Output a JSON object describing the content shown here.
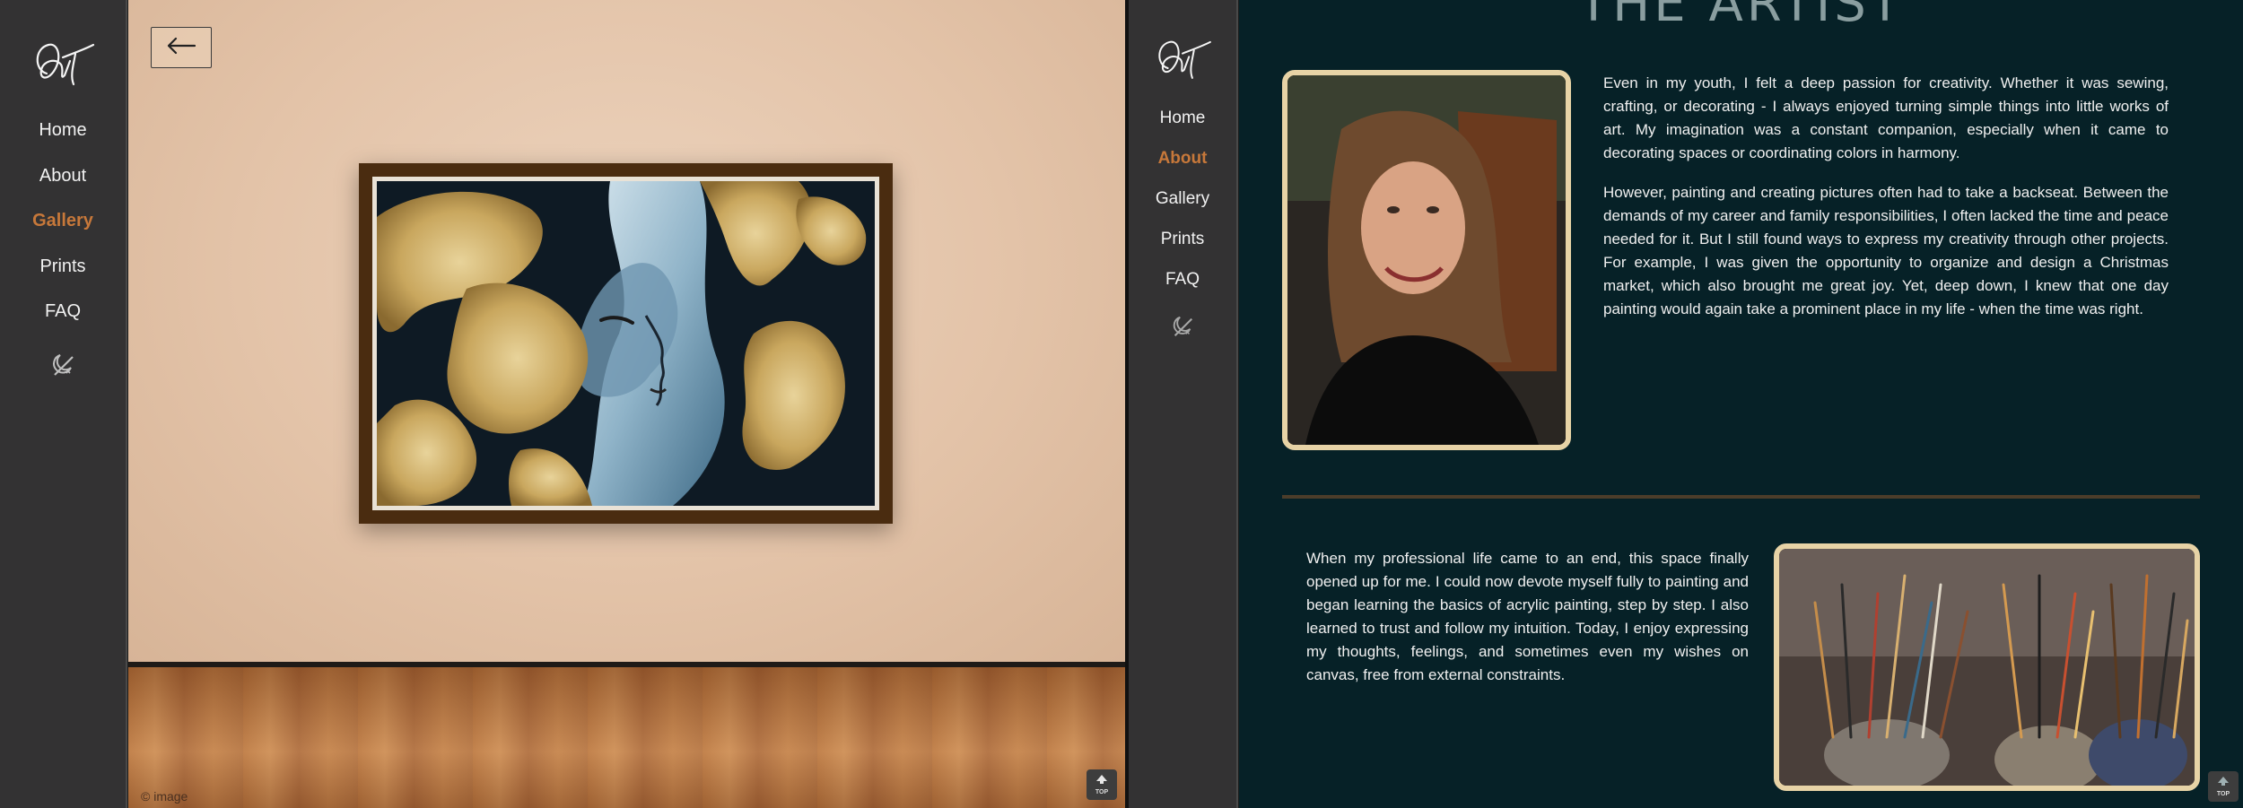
{
  "gallery_screen": {
    "nav": {
      "items": [
        {
          "label": "Home",
          "active": false
        },
        {
          "label": "About",
          "active": false
        },
        {
          "label": "Gallery",
          "active": true
        },
        {
          "label": "Prints",
          "active": false
        },
        {
          "label": "FAQ",
          "active": false
        }
      ]
    },
    "back_icon": "arrow-left-icon",
    "credit": "© image",
    "top_button_label": "TOP"
  },
  "about_screen": {
    "nav": {
      "items": [
        {
          "label": "Home",
          "active": false
        },
        {
          "label": "About",
          "active": true
        },
        {
          "label": "Gallery",
          "active": false
        },
        {
          "label": "Prints",
          "active": false
        },
        {
          "label": "FAQ",
          "active": false
        }
      ]
    },
    "heading": "THE ARTIST",
    "paragraphs": [
      "Even in my youth, I felt a deep passion for creativity. Whether it was sewing, crafting, or decorating - I always enjoyed turning simple things into little works of art. My imagination was a constant companion, especially when it came to decorating spaces or coordinating colors in harmony.",
      "However, painting and creating pictures often had to take a backseat. Between the demands of my career and family responsibilities, I often lacked the time and peace needed for it. But I still found ways to express my creativity through other projects. For example, I was given the opportunity to organize and design a Christmas market, which also brought me great joy. Yet, deep down, I knew that one day painting would again take a prominent place in my life - when the time was right.",
      "When my professional life came to an end, this space finally opened up for me. I could now devote myself fully to painting and began learning the basics of acrylic painting, step by step. I also learned to trust and follow my intuition. Today, I enjoy expressing my thoughts, feelings, and sometimes even my wishes on canvas, free from external constraints."
    ],
    "top_button_label": "TOP"
  },
  "colors": {
    "nav_bg": "#333233",
    "active_nav": "#c7783a",
    "about_bg": "#062127",
    "photo_border": "#e7d3a6"
  }
}
